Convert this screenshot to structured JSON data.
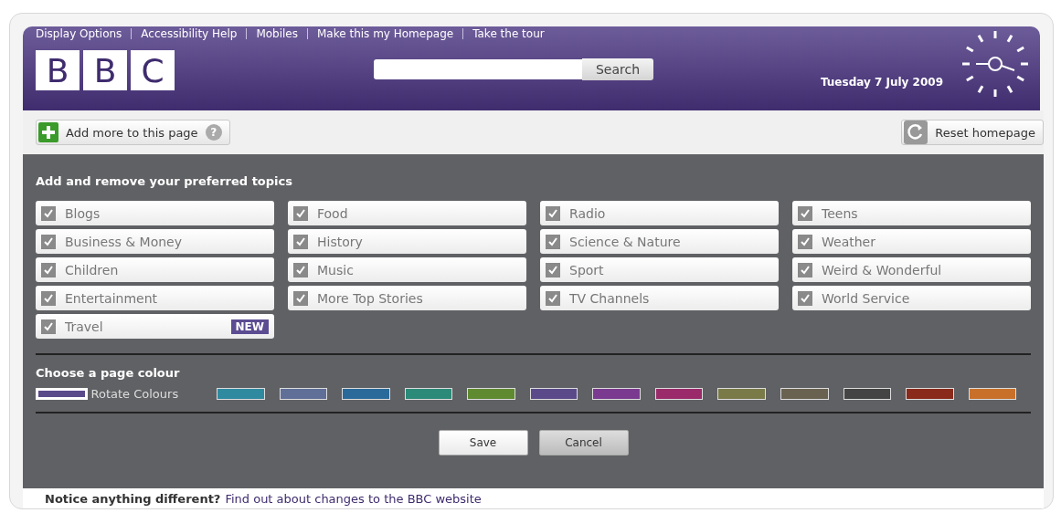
{
  "top_links": [
    "Display Options",
    "Accessibility Help",
    "Mobiles",
    "Make this my Homepage",
    "Take the tour"
  ],
  "logo": [
    "B",
    "B",
    "C"
  ],
  "search": {
    "button": "Search"
  },
  "date": "Tuesday 7 July 2009",
  "toolbar": {
    "add": "Add more to this page",
    "help": "?",
    "reset": "Reset homepage"
  },
  "topics_title": "Add and remove your preferred topics",
  "topic_columns": [
    [
      {
        "label": "Blogs",
        "checked": true
      },
      {
        "label": "Business & Money",
        "checked": true
      },
      {
        "label": "Children",
        "checked": true
      },
      {
        "label": "Entertainment",
        "checked": true
      },
      {
        "label": "Travel",
        "checked": true,
        "badge": "NEW"
      }
    ],
    [
      {
        "label": "Food",
        "checked": true
      },
      {
        "label": "History",
        "checked": true
      },
      {
        "label": "Music",
        "checked": true
      },
      {
        "label": "More Top Stories",
        "checked": true
      }
    ],
    [
      {
        "label": "Radio",
        "checked": true
      },
      {
        "label": "Science & Nature",
        "checked": true
      },
      {
        "label": "Sport",
        "checked": true
      },
      {
        "label": "TV Channels",
        "checked": true
      }
    ],
    [
      {
        "label": "Teens",
        "checked": true
      },
      {
        "label": "Weather",
        "checked": true
      },
      {
        "label": "Weird & Wonderful",
        "checked": true
      },
      {
        "label": "World Service",
        "checked": true
      }
    ]
  ],
  "colour_title": "Choose a page colour",
  "swatches": [
    {
      "color": "#5a4a8a",
      "selected": true,
      "label": "Rotate Colours"
    },
    {
      "color": "#2f8aa0",
      "selected": false
    },
    {
      "color": "#5f6f98",
      "selected": false
    },
    {
      "color": "#2a6a9a",
      "selected": false
    },
    {
      "color": "#2c8a78",
      "selected": false
    },
    {
      "color": "#5f8a30",
      "selected": false
    },
    {
      "color": "#5a4a8a",
      "selected": false
    },
    {
      "color": "#7a3a90",
      "selected": false
    },
    {
      "color": "#9a2a6a",
      "selected": false
    },
    {
      "color": "#7a7a48",
      "selected": false
    },
    {
      "color": "#6a6250",
      "selected": false
    },
    {
      "color": "#444444",
      "selected": false
    },
    {
      "color": "#8a2a1a",
      "selected": false
    },
    {
      "color": "#c8702a",
      "selected": false
    }
  ],
  "buttons": [
    "Save",
    "Cancel"
  ],
  "footer": {
    "notice": "Notice anything different?",
    "link": "Find out about changes to the BBC website"
  }
}
